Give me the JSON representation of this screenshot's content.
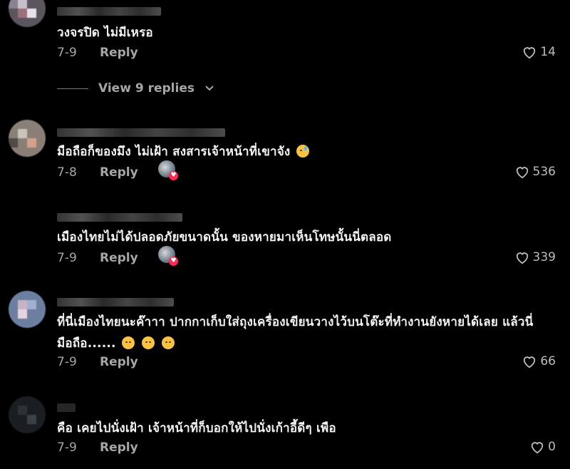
{
  "comments": [
    {
      "text": "วงจรปิด ไม่มีเหรอ",
      "date": "7-9",
      "reply": "Reply",
      "likes": "14",
      "creator_liked": false
    },
    {
      "text": "มือถือก็ของมึง ไม่เฝ้า สงสารเจ้าหน้าที่เขาจัง",
      "date": "7-8",
      "reply": "Reply",
      "likes": "536",
      "creator_liked": true,
      "emoji": "sweat-smile"
    },
    {
      "text": "เมืองไทยไม่ได้ปลอดภัยขนาดนั้น ของหายมาเห็นโทษนั้นนี่ตลอด",
      "date": "7-9",
      "reply": "Reply",
      "likes": "339",
      "creator_liked": true
    },
    {
      "text_line1": "ที่นี่เมืองไทยนะค๊าาา ปากกาเก็บใส่ถุงเครื่องเขียนวางไว้บนโต๊ะที่ทำงานยังหายได้เลย แล้วนี่",
      "text_line2": "มือถือ......",
      "date": "7-9",
      "reply": "Reply",
      "likes": "66",
      "creator_liked": false,
      "emoji": "pensive x3"
    },
    {
      "text": "คือ เคยไปนั่งเฝ้า เจ้าหน้าที่ก็บอกให้ไปนั่งเก้าอี้ดีๆ เพือ",
      "date": "7-9",
      "reply": "Reply",
      "likes": "0",
      "creator_liked": false
    }
  ],
  "view_replies": "View 9 replies",
  "colors": {
    "background": "#000000",
    "text": "#f2f2f2",
    "muted": "#a6a6a6",
    "like_badge": "#fe2c55"
  },
  "icons": {
    "like": "heart-outline-icon",
    "chevron": "chevron-down-icon"
  }
}
